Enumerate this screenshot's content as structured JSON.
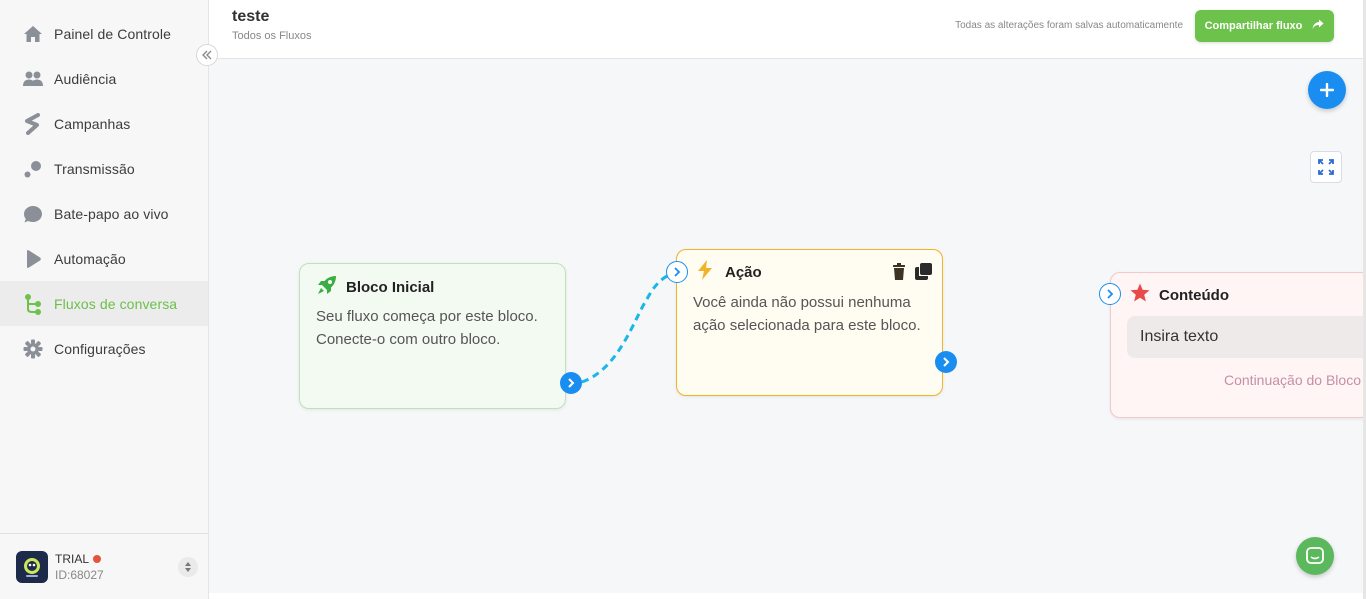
{
  "sidebar": {
    "items": [
      {
        "label": "Painel de Controle",
        "icon": "home-icon"
      },
      {
        "label": "Audiência",
        "icon": "users-icon"
      },
      {
        "label": "Campanhas",
        "icon": "campaign-icon"
      },
      {
        "label": "Transmissão",
        "icon": "broadcast-icon"
      },
      {
        "label": "Bate-papo ao vivo",
        "icon": "chat-bubble-icon"
      },
      {
        "label": "Automação",
        "icon": "automation-icon"
      },
      {
        "label": "Fluxos de conversa",
        "icon": "flow-icon",
        "active": true
      },
      {
        "label": "Configurações",
        "icon": "gear-icon"
      }
    ],
    "account": {
      "plan": "TRIAL",
      "id": "ID:68027"
    }
  },
  "header": {
    "title": "teste",
    "breadcrumb": "Todos os Fluxos",
    "saved_note": "Todas as alterações foram salvas automaticamente",
    "share_label": "Compartilhar fluxo"
  },
  "canvas": {
    "start_block": {
      "title": "Bloco Inicial",
      "text": "Seu fluxo começa por este bloco. Conecte-o com outro bloco."
    },
    "action_block": {
      "title": "Ação",
      "text": "Você ainda não possui nenhuma ação selecionada para este bloco."
    },
    "content_block": {
      "title": "Conteúdo",
      "text_box": "Insira texto",
      "continuation": "Continuação do Bloco"
    }
  },
  "colors": {
    "accent_green": "#6cc24a",
    "accent_blue": "#1a8ef0",
    "action_border": "#f0b429",
    "content_star": "#e84a4a"
  }
}
